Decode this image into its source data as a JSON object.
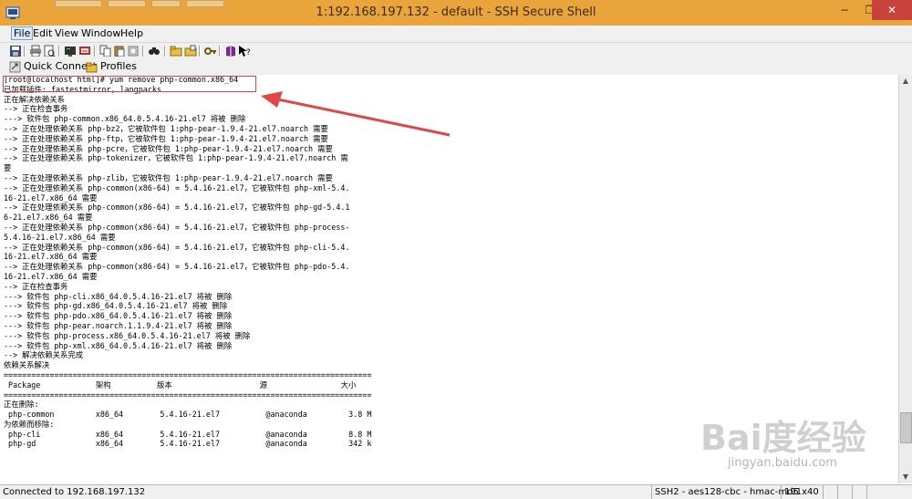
{
  "window": {
    "title": "1:192.168.197.132 - default - SSH Secure Shell",
    "minimize": "−",
    "maximize": "❐",
    "close": "✕"
  },
  "menu": [
    "File",
    "Edit",
    "View",
    "Window",
    "Help"
  ],
  "quickbar": {
    "quick_connect": "Quick Connect",
    "profiles": "Profiles"
  },
  "terminal": {
    "lines": [
      "[root@localhost html]# yum remove php-common.x86_64",
      "已加载插件: fastestmirror, langpacks",
      "正在解决依赖关系",
      "--> 正在检查事务",
      "---> 软件包 php-common.x86_64.0.5.4.16-21.el7 将被 删除",
      "--> 正在处理依赖关系 php-bz2，它被软件包 1:php-pear-1.9.4-21.el7.noarch 需要",
      "--> 正在处理依赖关系 php-ftp，它被软件包 1:php-pear-1.9.4-21.el7.noarch 需要",
      "--> 正在处理依赖关系 php-pcre，它被软件包 1:php-pear-1.9.4-21.el7.noarch 需要",
      "--> 正在处理依赖关系 php-tokenizer，它被软件包 1:php-pear-1.9.4-21.el7.noarch 需",
      "要",
      "--> 正在处理依赖关系 php-zlib，它被软件包 1:php-pear-1.9.4-21.el7.noarch 需要",
      "--> 正在处理依赖关系 php-common(x86-64) = 5.4.16-21.el7，它被软件包 php-xml-5.4.",
      "16-21.el7.x86_64 需要",
      "--> 正在处理依赖关系 php-common(x86-64) = 5.4.16-21.el7，它被软件包 php-gd-5.4.1",
      "6-21.el7.x86_64 需要",
      "--> 正在处理依赖关系 php-common(x86-64) = 5.4.16-21.el7，它被软件包 php-process-",
      "5.4.16-21.el7.x86_64 需要",
      "--> 正在处理依赖关系 php-common(x86-64) = 5.4.16-21.el7，它被软件包 php-cli-5.4.",
      "16-21.el7.x86_64 需要",
      "--> 正在处理依赖关系 php-common(x86-64) = 5.4.16-21.el7，它被软件包 php-pdo-5.4.",
      "16-21.el7.x86_64 需要",
      "--> 正在检查事务",
      "---> 软件包 php-cli.x86_64.0.5.4.16-21.el7 将被 删除",
      "---> 软件包 php-gd.x86_64.0.5.4.16-21.el7 将被 删除",
      "---> 软件包 php-pdo.x86_64.0.5.4.16-21.el7 将被 删除",
      "---> 软件包 php-pear.noarch.1.1.9.4-21.el7 将被 删除",
      "---> 软件包 php-process.x86_64.0.5.4.16-21.el7 将被 删除",
      "---> 软件包 php-xml.x86_64.0.5.4.16-21.el7 将被 删除",
      "--> 解决依赖关系完成",
      "",
      "依赖关系解决",
      "",
      "================================================================================",
      " Package            架构          版本                   源                大小",
      "================================================================================",
      "正在删除:",
      " php-common         x86_64        5.4.16-21.el7          @anaconda         3.8 M",
      "为依赖而移除:",
      " php-cli            x86_64        5.4.16-21.el7          @anaconda         8.8 M",
      " php-gd             x86_64        5.4.16-21.el7          @anaconda         342 k"
    ]
  },
  "status": {
    "connection": "Connected to 192.168.197.132",
    "cipher": "SSH2 - aes128-cbc - hmac-md5",
    "size": "191x40"
  },
  "watermark": {
    "brand": "Bai度经验",
    "url": "jingyan.baidu.com"
  }
}
